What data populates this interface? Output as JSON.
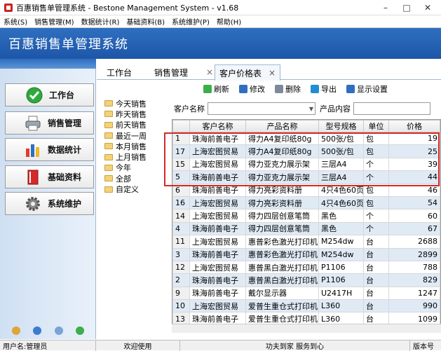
{
  "window": {
    "title": "百惠销售单管理系统 - Bestone Management System - v1.68"
  },
  "menu": [
    "系统(S)",
    "销售管理(M)",
    "数据统计(R)",
    "基础资料(B)",
    "系统维护(P)",
    "帮助(H)"
  ],
  "banner": {
    "title": "百惠销售单管理系统"
  },
  "nav": [
    {
      "label": "工作台",
      "icon": "check-icon"
    },
    {
      "label": "销售管理",
      "icon": "printer-icon"
    },
    {
      "label": "数据统计",
      "icon": "bar-chart-icon"
    },
    {
      "label": "基础资料",
      "icon": "book-icon"
    },
    {
      "label": "系统维护",
      "icon": "gear-icon"
    }
  ],
  "tabs": [
    "工作台",
    "销售管理",
    "客户价格表"
  ],
  "tree": [
    "今天销售",
    "昨天销售",
    "前天销售",
    "最近一周",
    "本月销售",
    "上月销售",
    "今年",
    "全部",
    "自定义"
  ],
  "toolbar": {
    "refresh": "刷新",
    "edit": "修改",
    "delete": "删除",
    "export": "导出",
    "display": "显示设置"
  },
  "search": {
    "customer_label": "客户名称",
    "product_label": "产品内容"
  },
  "table": {
    "headers": [
      "",
      "客户名称",
      "产品名称",
      "型号规格",
      "单位",
      "价格"
    ],
    "rows": [
      [
        "1",
        "珠海前善电子",
        "得力A4复印纸80g",
        "500张/包",
        "包",
        "19"
      ],
      [
        "17",
        "上海宏图贸易",
        "得力A4复印纸80g",
        "500张/包",
        "包",
        "25"
      ],
      [
        "15",
        "上海宏图贸易",
        "得力亚克力展示架",
        "三层A4",
        "个",
        "39"
      ],
      [
        "5",
        "珠海前善电子",
        "得力亚克力展示架",
        "三层A4",
        "个",
        "44"
      ],
      [
        "6",
        "珠海前善电子",
        "得力亮彩资料册",
        "4只4色60页",
        "包",
        "46"
      ],
      [
        "16",
        "上海宏图贸易",
        "得力亮彩资料册",
        "4只4色60页",
        "包",
        "54"
      ],
      [
        "14",
        "上海宏图贸易",
        "得力四层创意笔筒",
        "黑色",
        "个",
        "60"
      ],
      [
        "4",
        "珠海前善电子",
        "得力四层创意笔筒",
        "黑色",
        "个",
        "67"
      ],
      [
        "11",
        "上海宏图贸易",
        "惠普彩色激光打印机",
        "M254dw",
        "台",
        "2688"
      ],
      [
        "3",
        "珠海前善电子",
        "惠普彩色激光打印机",
        "M254dw",
        "台",
        "2899"
      ],
      [
        "12",
        "上海宏图贸易",
        "惠普黑白激光打印机",
        "P1106",
        "台",
        "788"
      ],
      [
        "2",
        "珠海前善电子",
        "惠普黑白激光打印机",
        "P1106",
        "台",
        "829"
      ],
      [
        "9",
        "珠海前善电子",
        "戴尔显示器",
        "U2417H",
        "台",
        "1247"
      ],
      [
        "10",
        "上海宏图贸易",
        "爱普生重仓式打印机",
        "L360",
        "台",
        "990"
      ],
      [
        "13",
        "珠海前善电子",
        "爱普生重仓式打印机",
        "L360",
        "台",
        "1099"
      ]
    ]
  },
  "status": {
    "user": "用户名:管理员",
    "welcome": "欢迎使用",
    "motto": "功夫到家 服务到心",
    "version": "版本号"
  },
  "colors": {
    "banner": "#1d56a8",
    "highlight": "#d42a2a",
    "row_alt": "#dfeaf5"
  }
}
